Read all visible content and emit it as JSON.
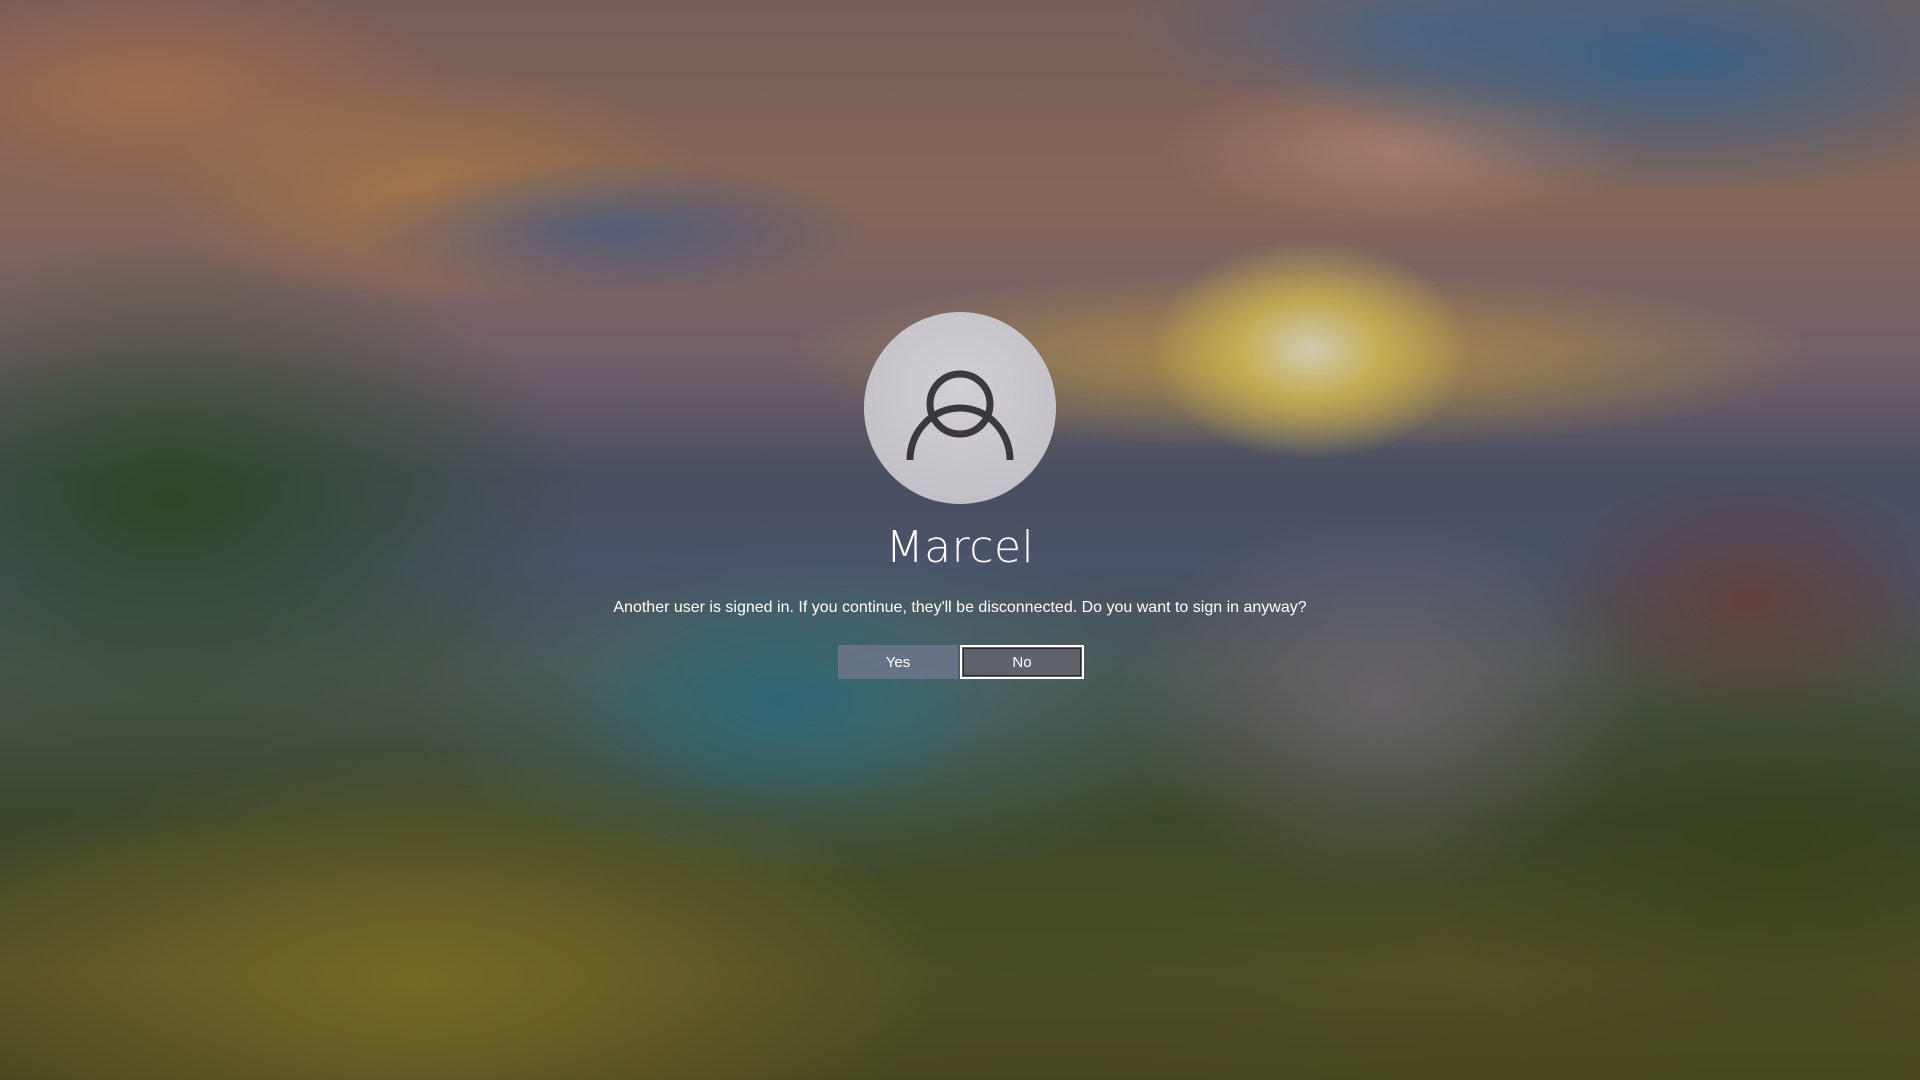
{
  "screen": {
    "type": "windows-sign-in",
    "accent_color": "#6e768c"
  },
  "user": {
    "name": "Marcel",
    "avatar_icon": "user-icon"
  },
  "dialog": {
    "message": "Another user is signed in. If you continue, they'll be disconnected. Do you want to sign in anyway?",
    "yes_label": "Yes",
    "no_label": "No",
    "focused_button": "No"
  }
}
